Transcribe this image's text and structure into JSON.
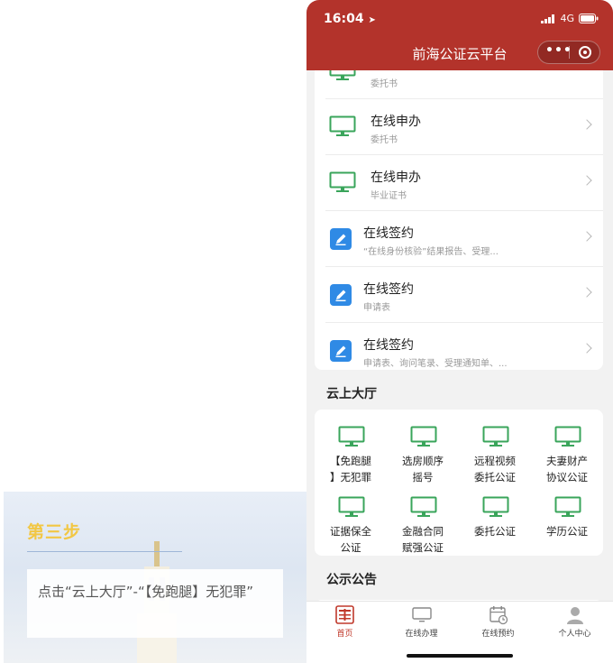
{
  "article": {
    "step_title": "第三步",
    "step_text": "点击“云上大厅”-“【免跑腿】无犯罪”"
  },
  "status_bar": {
    "time": "16:04",
    "network": "4G"
  },
  "nav": {
    "title": "前海公证云平台",
    "more": "•••"
  },
  "list": [
    {
      "title": "",
      "subtitle": "委托书",
      "icon": "monitor-icon"
    },
    {
      "title": "在线申办",
      "subtitle": "委托书",
      "icon": "monitor-icon"
    },
    {
      "title": "在线申办",
      "subtitle": "毕业证书",
      "icon": "monitor-icon"
    },
    {
      "title": "在线签约",
      "subtitle": "“在线身份核验”结果报告、受理...",
      "icon": "pen-icon"
    },
    {
      "title": "在线签约",
      "subtitle": "申请表",
      "icon": "pen-icon"
    },
    {
      "title": "在线签约",
      "subtitle": "申请表、询问笔录、受理通知单、...",
      "icon": "pen-icon"
    }
  ],
  "sections": {
    "hall": "云上大厅",
    "notice": "公示公告"
  },
  "hall_items": [
    {
      "line1": "【免跑腿",
      "line2": "】无犯罪"
    },
    {
      "line1": "选房顺序",
      "line2": "摇号"
    },
    {
      "line1": "远程视频",
      "line2": "委托公证"
    },
    {
      "line1": "夫妻财产",
      "line2": "协议公证"
    },
    {
      "line1": "证据保全",
      "line2": "公证"
    },
    {
      "line1": "金融合同",
      "line2": "赋强公证"
    },
    {
      "line1": "委托公证",
      "line2": ""
    },
    {
      "line1": "学历公证",
      "line2": ""
    }
  ],
  "tabs": [
    {
      "label": "首页",
      "icon": "home-seal-icon"
    },
    {
      "label": "在线办理",
      "icon": "monitor-icon"
    },
    {
      "label": "在线预约",
      "icon": "calendar-icon"
    },
    {
      "label": "个人中心",
      "icon": "person-icon"
    }
  ],
  "colors": {
    "brand_red": "#b3332b",
    "icon_green": "#3aa55b",
    "icon_blue": "#2f8ae5",
    "step_yellow": "#f2c744"
  }
}
